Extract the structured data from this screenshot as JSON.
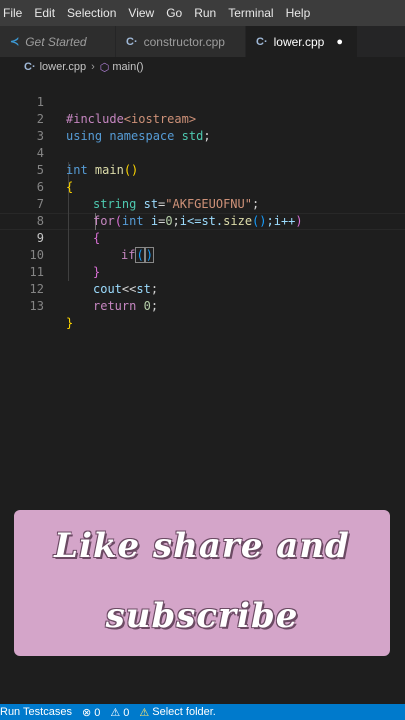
{
  "menu": [
    "File",
    "Edit",
    "Selection",
    "View",
    "Go",
    "Run",
    "Terminal",
    "Help"
  ],
  "tabs": [
    {
      "label": "Get Started",
      "icon": "vscode-logo-icon"
    },
    {
      "label": "constructor.cpp",
      "icon": "cpp-file-icon"
    },
    {
      "label": "lower.cpp",
      "icon": "cpp-file-icon",
      "dirty_marker": "●"
    }
  ],
  "breadcrumb": {
    "file": "lower.cpp",
    "symbol": "main()"
  },
  "line_numbers": [
    "1",
    "2",
    "3",
    "4",
    "5",
    "6",
    "7",
    "8",
    "9",
    "10",
    "11",
    "12",
    "13"
  ],
  "current_line": "9",
  "code": {
    "l1_pp": "#include",
    "l1_inc": "<iostream>",
    "l2_using": "using",
    "l2_namespace": "namespace",
    "l2_std": "std",
    "l2_semi": ";",
    "l4_int": "int",
    "l4_main": "main",
    "l4_parens": "()",
    "l5_brace": "{",
    "l6_type": "string",
    "l6_var": "st",
    "l6_eq": "=",
    "l6_str": "\"AKFGEUOFNU\"",
    "l6_semi": ";",
    "l7_for": "for",
    "l7_open": "(",
    "l7_int": "int",
    "l7_i": "i",
    "l7_eq": "=",
    "l7_zero": "0",
    "l7_semi1": ";",
    "l7_cond": "i<=st.",
    "l7_size": "size",
    "l7_sizeparens": "()",
    "l7_rest": ";i++",
    "l7_close": ")",
    "l8_brace": "{",
    "l9_if": "if",
    "l9_open": "(",
    "l9_close": ")",
    "l10_brace": "}",
    "l11_cout": "cout",
    "l11_op": "<<",
    "l11_st": "st",
    "l11_semi": ";",
    "l12_return": "return",
    "l12_zero": "0",
    "l12_semi": ";",
    "l13_brace": "}"
  },
  "overlay": {
    "line1": "Like share and",
    "line2": "subscribe"
  },
  "status": {
    "run": "Run Testcases",
    "errors": "⊗ 0",
    "warnings": "⚠ 0",
    "folder_icon": "⚠",
    "folder": "Select folder."
  }
}
